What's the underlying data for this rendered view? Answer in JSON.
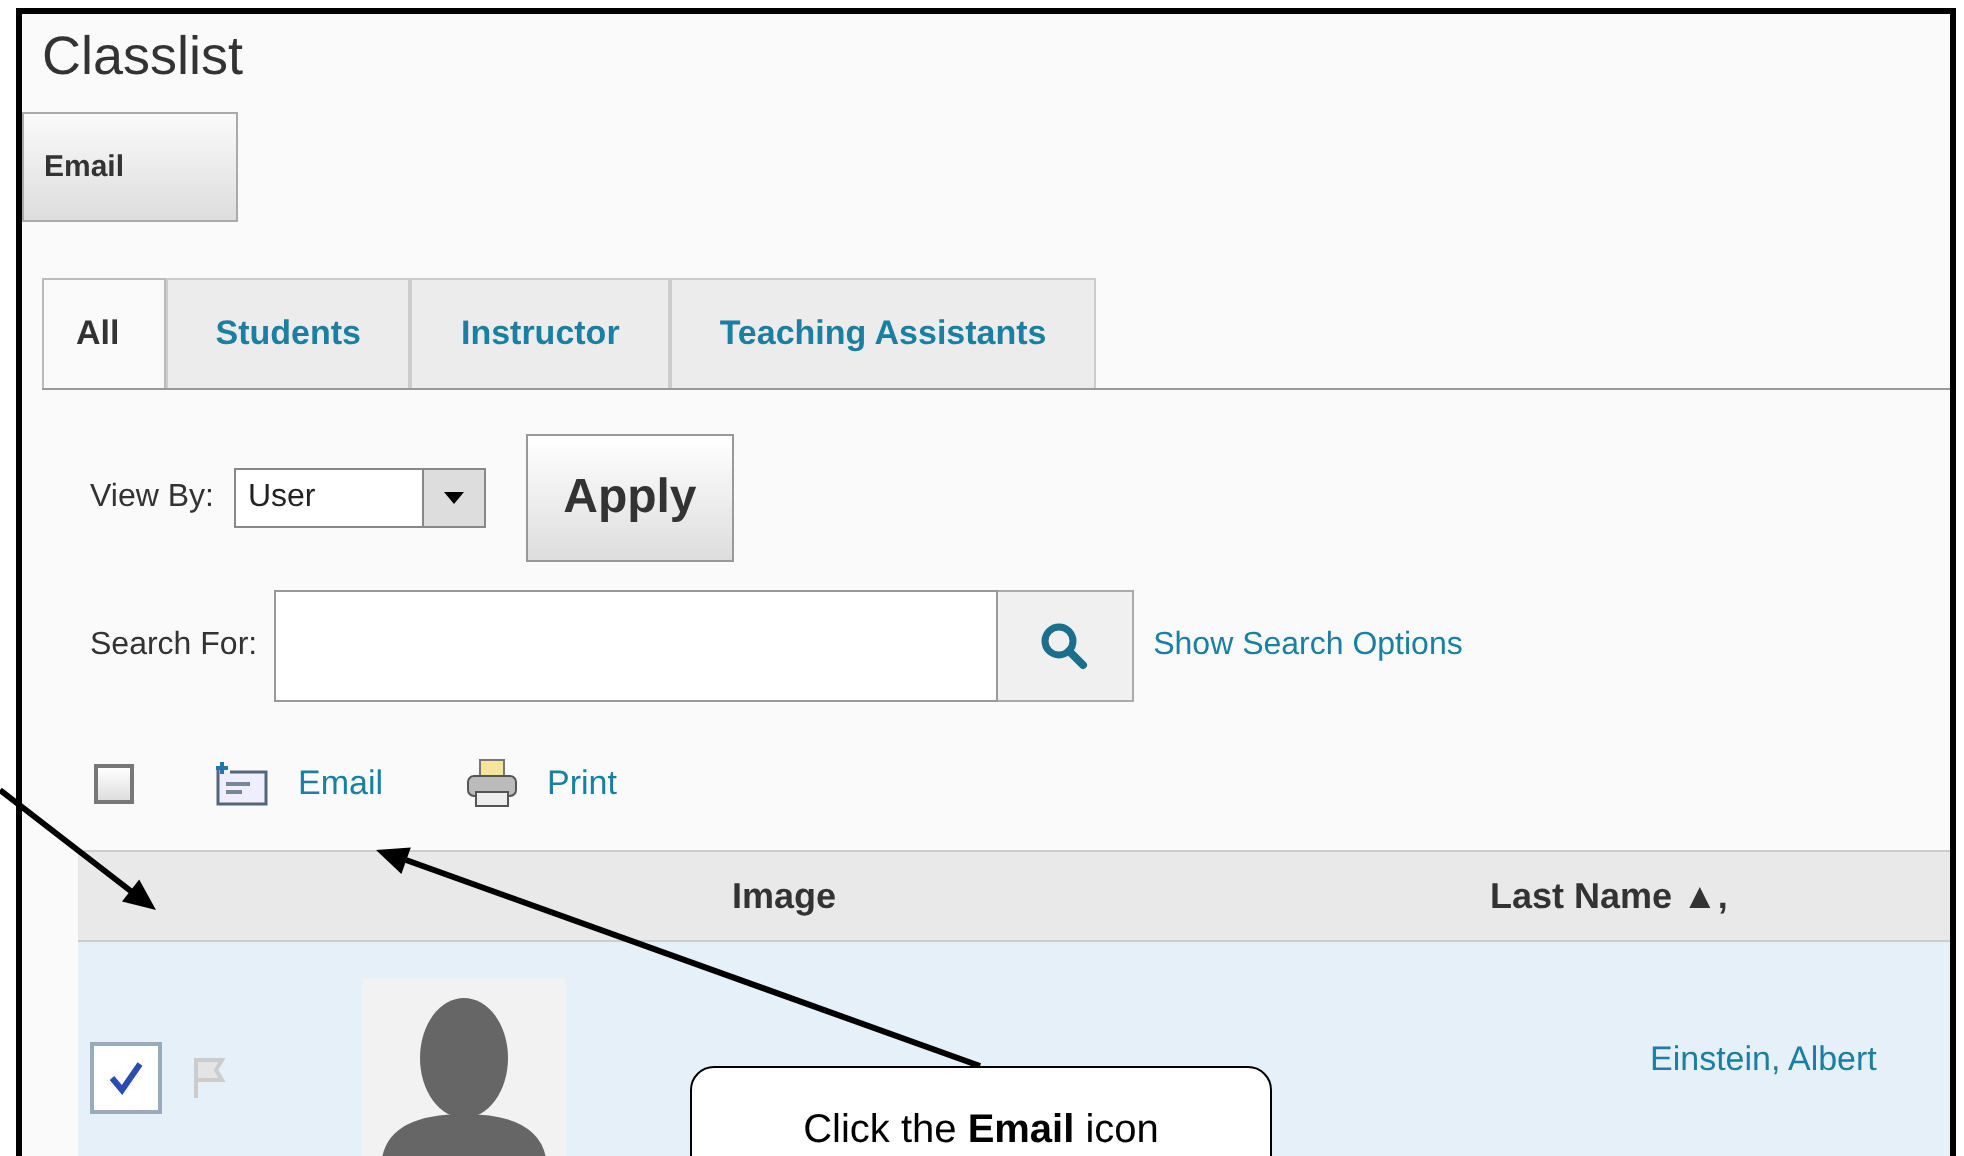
{
  "page": {
    "title": "Classlist"
  },
  "top_button": "Email",
  "tabs": [
    {
      "label": "All",
      "selected": true
    },
    {
      "label": "Students",
      "selected": false
    },
    {
      "label": "Instructor",
      "selected": false
    },
    {
      "label": "Teaching Assistants",
      "selected": false
    }
  ],
  "view_by": {
    "label": "View By:",
    "value": "User"
  },
  "apply_button": "Apply",
  "search": {
    "label": "Search For:",
    "link": "Show Search Options"
  },
  "select_all": {
    "checked": false
  },
  "actions": [
    {
      "kind": "email",
      "label": "Email"
    },
    {
      "kind": "print",
      "label": "Print"
    }
  ],
  "table": {
    "columns": [
      "Image",
      "Last Name ▲,"
    ],
    "rows": [
      {
        "checked": true,
        "name": "Einstein, Albert"
      }
    ]
  },
  "callout": {
    "text": "Click the **Email** icon"
  }
}
